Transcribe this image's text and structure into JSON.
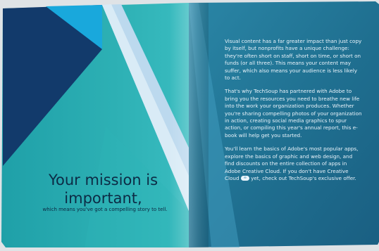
{
  "left_page": {
    "headline_line1": "Your mission is",
    "headline_line2": "important,",
    "tagline": "which means you've got a compelling story to tell."
  },
  "right_page": {
    "paragraph1": "Visual content has a far greater impact than just copy by itself, but nonprofits have a unique challenge: they're often short on staff, short on time, or short on funds (or all three). This means your content may suffer, which also means your audience is less likely to act.",
    "paragraph2": "That's why TechSoup has partnered with Adobe to bring you the resources you need to breathe new life into the work your organization produces. Whether you're sharing compelling photos of your organization in action, creating social media graphics to spur action, or compiling this year's annual report, this e-book will help get you started.",
    "paragraph3_part1": "You'll learn the basics of Adobe's most popular apps, explore the basics of graphic and web design, and find discounts on the entire collection of apps in Adobe Creative Cloud. If you don't have Creative Cloud",
    "paragraph3_part2": "yet, check out TechSoup's exclusive offer."
  },
  "icons": {
    "creative_cloud": "creative-cloud-icon"
  },
  "colors": {
    "navy": "#123a6b",
    "sky_blue": "#1aa6d6",
    "teal": "#27a7ae",
    "right_page_blue": "#1d6c8c",
    "headline_text": "#0c2b45"
  }
}
